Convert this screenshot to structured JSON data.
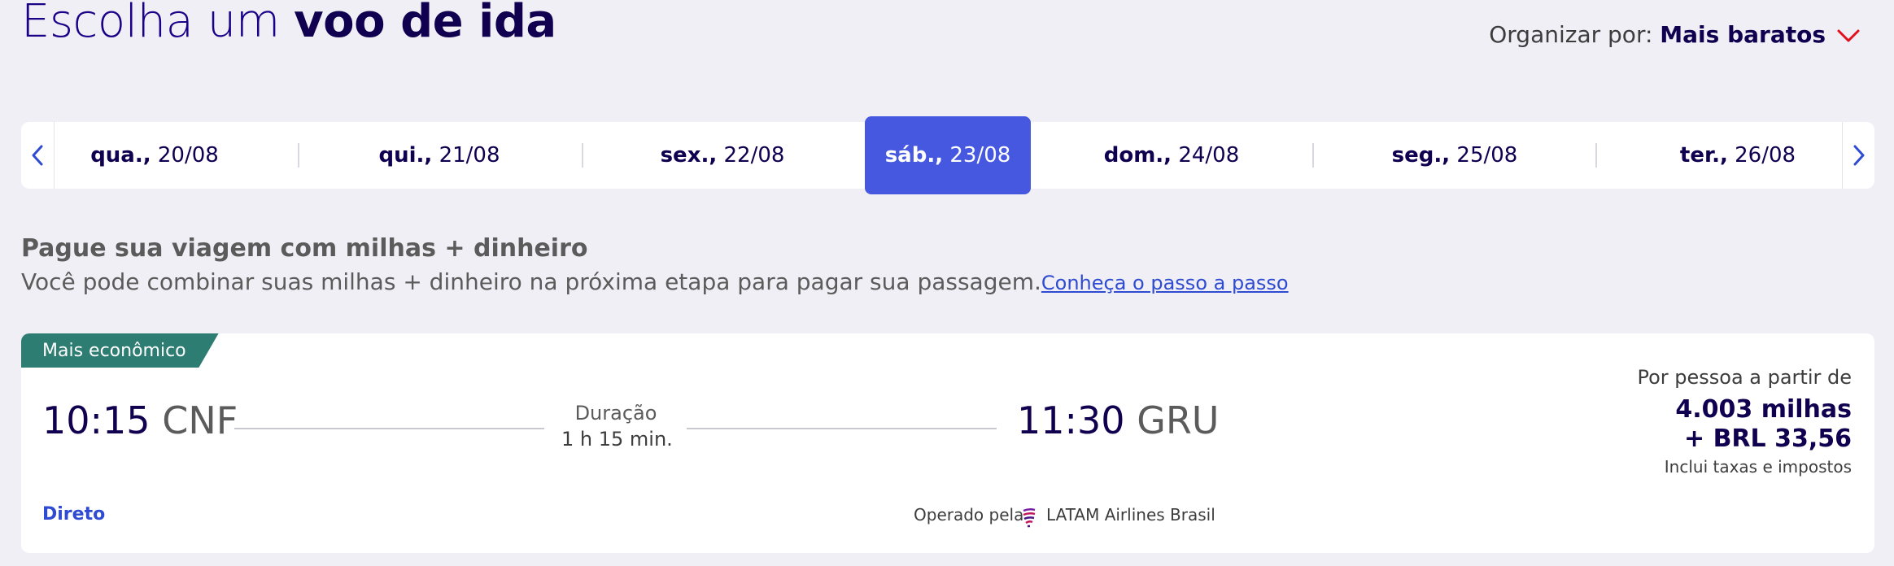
{
  "header": {
    "title_prefix": "Escolha um ",
    "title_bold": "voo de ida",
    "sort_label": "Organizar por:",
    "sort_value": "Mais baratos"
  },
  "dates": [
    {
      "weekday": "qua.,",
      "date": "20/08"
    },
    {
      "weekday": "qui.,",
      "date": "21/08"
    },
    {
      "weekday": "sex.,",
      "date": "22/08"
    },
    {
      "weekday": "sáb.,",
      "date": "23/08",
      "selected": true
    },
    {
      "weekday": "dom.,",
      "date": "24/08"
    },
    {
      "weekday": "seg.,",
      "date": "25/08"
    },
    {
      "weekday": "ter.,",
      "date": "26/08"
    }
  ],
  "promo": {
    "title": "Pague sua viagem com milhas + dinheiro",
    "body": "Você pode combinar suas milhas + dinheiro na próxima etapa para pagar sua passagem.",
    "link": "Conheça o passo a passo"
  },
  "flight": {
    "badge": "Mais econômico",
    "depart_time": "10:15",
    "depart_code": "CNF",
    "duration_label": "Duração",
    "duration_value": "1 h 15 min.",
    "arrive_time": "11:30",
    "arrive_code": "GRU",
    "price_label": "Por pessoa a partir de",
    "price_miles": "4.003 milhas",
    "price_cash": "+ BRL 33,56",
    "price_note": "Inclui taxas e impostos",
    "stops": "Direto",
    "operated_label": "Operado pela",
    "carrier": "LATAM Airlines Brasil"
  },
  "colors": {
    "brand_navy": "#10004f",
    "accent_blue": "#4658df",
    "badge_teal": "#2e7d73",
    "chevron_red": "#e1111c"
  }
}
